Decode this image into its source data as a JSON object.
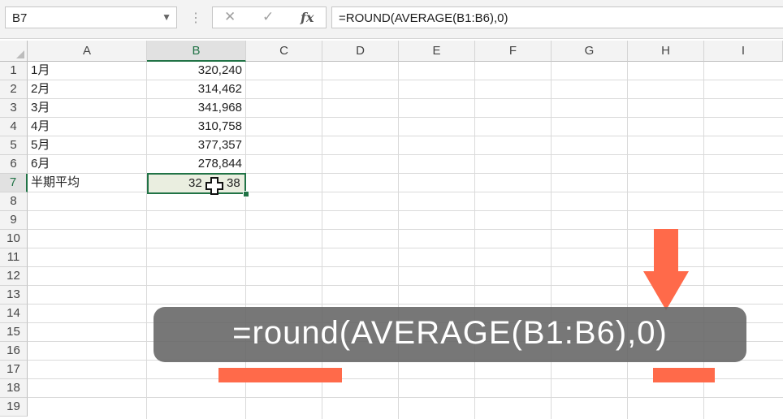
{
  "formula_bar": {
    "name_box": "B7",
    "formula": "=ROUND(AVERAGE(B1:B6),0)",
    "cancel_icon": "close-icon",
    "enter_icon": "check-icon",
    "fx_label": "fx"
  },
  "columns": [
    "A",
    "B",
    "C",
    "D",
    "E",
    "F",
    "G",
    "H",
    "I"
  ],
  "active_column": "B",
  "rows": [
    "1",
    "2",
    "3",
    "4",
    "5",
    "6",
    "7",
    "8",
    "9",
    "10",
    "11",
    "12",
    "13",
    "14",
    "15",
    "16",
    "17",
    "18",
    "19"
  ],
  "active_row": "7",
  "cells": {
    "a1": "1月",
    "b1": "320,240",
    "a2": "2月",
    "b2": "314,462",
    "a3": "3月",
    "b3": "341,968",
    "a4": "4月",
    "b4": "310,758",
    "a5": "5月",
    "b5": "377,357",
    "a6": "6月",
    "b6": "278,844",
    "a7": "半期平均",
    "b7_left": "32",
    "b7_right": "38"
  },
  "overlay": {
    "formula_text": "=round(AVERAGE(B1:B6),0)",
    "accent_color": "#ff6a4a"
  }
}
